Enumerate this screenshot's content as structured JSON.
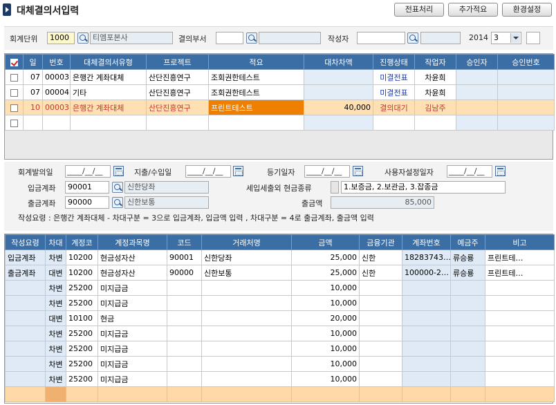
{
  "title": "대체결의서입력",
  "toolbar": {
    "voucher": "전표처리",
    "add_note": "추가적요",
    "settings": "환경설정"
  },
  "filter": {
    "unit_label": "회계단위",
    "unit_code": "1000",
    "unit_name": "티엠포본사",
    "dept_label": "결의부서",
    "dept_code": "",
    "dept_name": "",
    "writer_label": "작성자",
    "writer_code": "",
    "writer_name": "",
    "year": "2014",
    "month": "3",
    "extra": ""
  },
  "grid1": {
    "headers": [
      "",
      "일",
      "번호",
      "대체결의서유형",
      "프로젝트",
      "적요",
      "대차차액",
      "진행상태",
      "작업자",
      "승인자",
      "승인번호"
    ],
    "rows": [
      {
        "day": "07",
        "no": "00003",
        "type": "은행간 계좌대체",
        "project": "산단진흥연구",
        "desc": "조회권한테스트",
        "diff": "",
        "status": "미결전표",
        "worker": "차윤희",
        "approver": "",
        "approval_no": ""
      },
      {
        "day": "07",
        "no": "00004",
        "type": "기타",
        "project": "산단진흥연구",
        "desc": "조회권한테스트",
        "diff": "",
        "status": "미결전표",
        "worker": "차윤희",
        "approver": "",
        "approval_no": ""
      },
      {
        "day": "10",
        "no": "00003",
        "type": "은행간 계좌대체",
        "project": "산단진흥연구",
        "desc": "프린트테스트",
        "diff": "40,000",
        "status": "결의대기",
        "worker": "김남주",
        "approver": "",
        "approval_no": ""
      }
    ]
  },
  "form": {
    "acct_date_label": "회계발의일",
    "acct_date": "____/__/__",
    "io_date_label": "지출/수입일",
    "io_date": "____/__/__",
    "reg_date_label": "등기일자",
    "reg_date": "____/__/__",
    "user_date_label": "사용자설정일자",
    "user_date": "____/__/__",
    "in_acct_label": "입금계좌",
    "in_acct_code": "90001",
    "in_acct_name": "신한당좌",
    "tax_label": "세입세출외 현금종류",
    "tax_value": "1.보증금, 2.보관금, 3.잡종금",
    "out_acct_label": "출금계좌",
    "out_acct_code": "90000",
    "out_acct_name": "신한보통",
    "out_amount_label": "출금액",
    "out_amount": "85,000",
    "guide": "작성요령 : 은행간 계좌대체 - 차대구분 = 3으로 입금계좌, 입금액 입력 , 차대구분 = 4로 출금계좌, 출금액 입력"
  },
  "grid2": {
    "headers": [
      "작성요령",
      "차대",
      "계정코",
      "계정과목명",
      "코드",
      "거래처명",
      "금액",
      "금융기관",
      "계좌번호",
      "예금주",
      "비고"
    ],
    "rows": [
      {
        "guide": "입금계좌",
        "dc": "차변",
        "acct": "10200",
        "acct_name": "현금성자산",
        "code": "90001",
        "partner": "신한당좌",
        "amount": "25,000",
        "bank": "신한",
        "account_no": "18283743…",
        "holder": "류승룡",
        "note": "프린트테…"
      },
      {
        "guide": "출금계좌",
        "dc": "대변",
        "acct": "10200",
        "acct_name": "현금성자산",
        "code": "90000",
        "partner": "신한보통",
        "amount": "25,000",
        "bank": "신한",
        "account_no": "100000-2…",
        "holder": "류승룡",
        "note": "프린트테…"
      },
      {
        "guide": "",
        "dc": "차변",
        "acct": "25200",
        "acct_name": "미지급금",
        "code": "",
        "partner": "",
        "amount": "10,000",
        "bank": "",
        "account_no": "",
        "holder": "",
        "note": ""
      },
      {
        "guide": "",
        "dc": "차변",
        "acct": "25200",
        "acct_name": "미지급금",
        "code": "",
        "partner": "",
        "amount": "10,000",
        "bank": "",
        "account_no": "",
        "holder": "",
        "note": ""
      },
      {
        "guide": "",
        "dc": "대변",
        "acct": "10100",
        "acct_name": "현금",
        "code": "",
        "partner": "",
        "amount": "20,000",
        "bank": "",
        "account_no": "",
        "holder": "",
        "note": ""
      },
      {
        "guide": "",
        "dc": "차변",
        "acct": "25200",
        "acct_name": "미지급금",
        "code": "",
        "partner": "",
        "amount": "10,000",
        "bank": "",
        "account_no": "",
        "holder": "",
        "note": ""
      },
      {
        "guide": "",
        "dc": "차변",
        "acct": "25200",
        "acct_name": "미지급금",
        "code": "",
        "partner": "",
        "amount": "10,000",
        "bank": "",
        "account_no": "",
        "holder": "",
        "note": ""
      },
      {
        "guide": "",
        "dc": "차변",
        "acct": "25200",
        "acct_name": "미지급금",
        "code": "",
        "partner": "",
        "amount": "10,000",
        "bank": "",
        "account_no": "",
        "holder": "",
        "note": ""
      },
      {
        "guide": "",
        "dc": "차변",
        "acct": "25200",
        "acct_name": "미지급금",
        "code": "",
        "partner": "",
        "amount": "10,000",
        "bank": "",
        "account_no": "",
        "holder": "",
        "note": ""
      }
    ]
  }
}
